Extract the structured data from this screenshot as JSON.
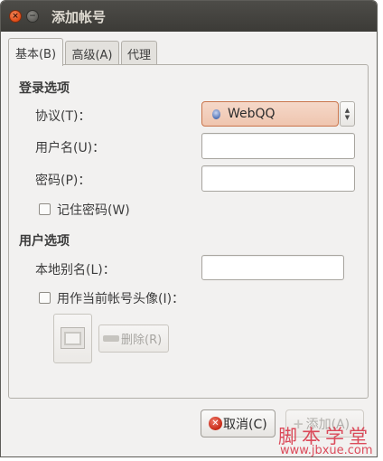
{
  "window": {
    "title": "添加帐号",
    "close_glyph": "×",
    "minimize_glyph": "−"
  },
  "tabs": [
    {
      "label": "基本(B)",
      "active": true
    },
    {
      "label": "高级(A)",
      "active": false
    },
    {
      "label": "代理",
      "active": false
    }
  ],
  "login_section": {
    "title": "登录选项",
    "protocol_label": "协议(T)：",
    "protocol_value": "WebQQ",
    "protocol_icon": "webqq-icon",
    "username_label": "用户名(U)：",
    "username_value": "",
    "password_label": "密码(P)：",
    "password_value": "",
    "remember_password_label": "记住密码(W)",
    "remember_password_checked": false
  },
  "user_section": {
    "title": "用户选项",
    "alias_label": "本地别名(L)：",
    "alias_value": "",
    "use_avatar_label": "用作当前帐号头像(I)：",
    "use_avatar_checked": false,
    "remove_label": "删除(R)"
  },
  "buttons": {
    "cancel_label": "取消(C)",
    "add_label": "添加(A)"
  },
  "watermark": {
    "text": "脚本学堂",
    "url": "www.jbxue.com"
  },
  "colors": {
    "titlebar": "#3c3b37",
    "window_bg": "#f2f1f0",
    "combo_accent": "#c9754c",
    "close_button": "#df4a16",
    "watermark": "#d9384a"
  }
}
